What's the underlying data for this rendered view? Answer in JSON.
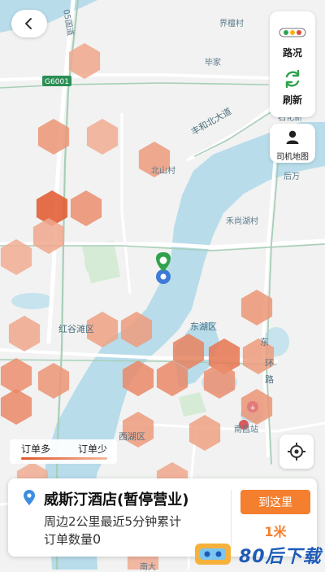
{
  "map": {
    "labels": {
      "jietang": "界檀村",
      "bijia": "毕家",
      "fenghe": "丰和北大道",
      "beishan": "北山村",
      "houwan": "后万",
      "hecang": "禾尚湖村",
      "honggutan": "红谷滩区",
      "donghu": "东湖区",
      "dong": "东",
      "huan": "环",
      "lu": "路",
      "xihu": "西湖区",
      "nanchang": "南昌站",
      "nanda": "南大",
      "shihuaxin": "石化新",
      "g6001": "G6001",
      "guodao": "05国道"
    }
  },
  "nav": {
    "back_icon": "chevron-left-icon"
  },
  "controls": {
    "traffic_label": "路况",
    "refresh_label": "刷新",
    "driver_map_label": "司机地图"
  },
  "legend": {
    "more_label": "订单多",
    "less_label": "订单少"
  },
  "card": {
    "hotel_name": "威斯汀酒店(暂停营业)",
    "stats_line1": "周边2公里最近5分钟累计",
    "stats_line2_prefix": "订单数量",
    "order_count": "0",
    "goto_label": "到这里",
    "distance": "1米"
  },
  "watermark": {
    "text": "80后下载"
  },
  "colors": {
    "accent": "#f47f2e",
    "heat_high": "#e0572c",
    "heat_low": "#f8d2bf",
    "water": "#b8dcea",
    "pin_green": "#2fa24d"
  }
}
